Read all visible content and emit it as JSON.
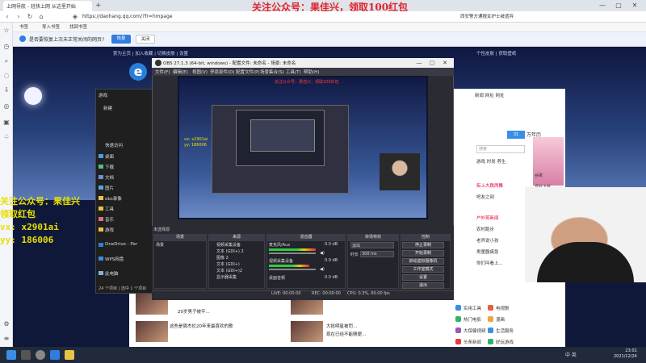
{
  "browser": {
    "tab_title": "上网导航 - 轻快上网 从这里开始",
    "url": "https://daohang.qq.com/?fr=hmpage",
    "address_right": "西安警方通报女护士被遗弃",
    "bookmarks": [
      "书签",
      "导入书签",
      "找回书签"
    ],
    "infobar_text": "是否要恢复上次未正常关闭的网页?",
    "infobar_yes": "恢复",
    "infobar_no": "关闭"
  },
  "watermark": "关注公众号：果佳兴，领取100红包",
  "page": {
    "topnav": "获为主页 | 加入收藏 | 切换皮肤 | 设置",
    "topright": "个性皮肤 | 获取壁纸",
    "logo": "e",
    "right_tabs": "新闻  网址 网址",
    "calendar_label": "万年历",
    "calendar_badge": "31",
    "search_placeholder": "搜索",
    "news": [
      "游戏  时尚  养生",
      "街上大跳两舞",
      "吧友之刻",
      "户外剪新闻",
      "农村跑步",
      "老师说小孩",
      "男童腹痛急",
      "你们叫看上..."
    ],
    "ad_label": "谷歌",
    "ad_label2": "现在下载",
    "bottom_items": [
      "20岁男子被平...",
      "这些是周杰伦20年来最喜欢的歌",
      "大批明星被罚...",
      "现在已经不能随便..."
    ],
    "bottom_right": [
      "实用工具",
      "电视剧",
      "热门电影",
      "漫画",
      "大保健视频",
      "生活服务",
      "头条新闻",
      "好玩游戏"
    ]
  },
  "explorer": {
    "title": "游戏",
    "new_label": "新建",
    "items": [
      "快速访问",
      "桌面",
      "下载",
      "文档",
      "图片",
      "obs录像",
      "工具",
      "音乐",
      "游戏",
      "OneDrive - Per",
      "WPS网盘",
      "此电脑"
    ],
    "status": "24 个项目 | 选中 1 个项目"
  },
  "obs": {
    "title": "OBS 27.1.3 (64-bit, windows) - 配置文件: 未命名 - 场景: 未命名",
    "menu": [
      "文件(F)",
      "编辑(E)",
      "视图(V)",
      "停靠部件(D)",
      "配置文件(P)",
      "场景集合(S)",
      "工具(T)",
      "帮助(H)"
    ],
    "preview_text": "关注公众号：果佳兴，领取100红包",
    "no_source": "未选择源",
    "docks": [
      "场景",
      "来源",
      "混音器",
      "转场特效",
      "控制"
    ],
    "scene_name": "场景",
    "sources": [
      "视频采集设备",
      "文本 (GDI+) 2",
      "图像 2",
      "文本 (GDI+)",
      "文本 (GDI+)2",
      "显示器采集"
    ],
    "mixer": [
      {
        "name": "麦克风/Aux",
        "level": "0.0 dB"
      },
      {
        "name": "视频采集设备",
        "level": "0.0 dB"
      },
      {
        "name": "桌面音频",
        "level": "0.0 dB"
      }
    ],
    "transition": "淡出",
    "duration_label": "时长",
    "duration_value": "300 ms",
    "controls": [
      "停止录制",
      "开始录制",
      "启动虚拟摄像机",
      "工作室模式",
      "设置",
      "退出"
    ],
    "status": [
      "LIVE: 00:00:00",
      "REC: 00:00:00",
      "CPU: 0.3%, 60.00 fps"
    ]
  },
  "overlay_left": [
    "关注公众号：果佳兴",
    "领取红包",
    "vx: x2901ai",
    "yy: 186006"
  ],
  "taskbar": {
    "time": "23:01",
    "date": "2021/12/24",
    "tray": "中  英"
  }
}
